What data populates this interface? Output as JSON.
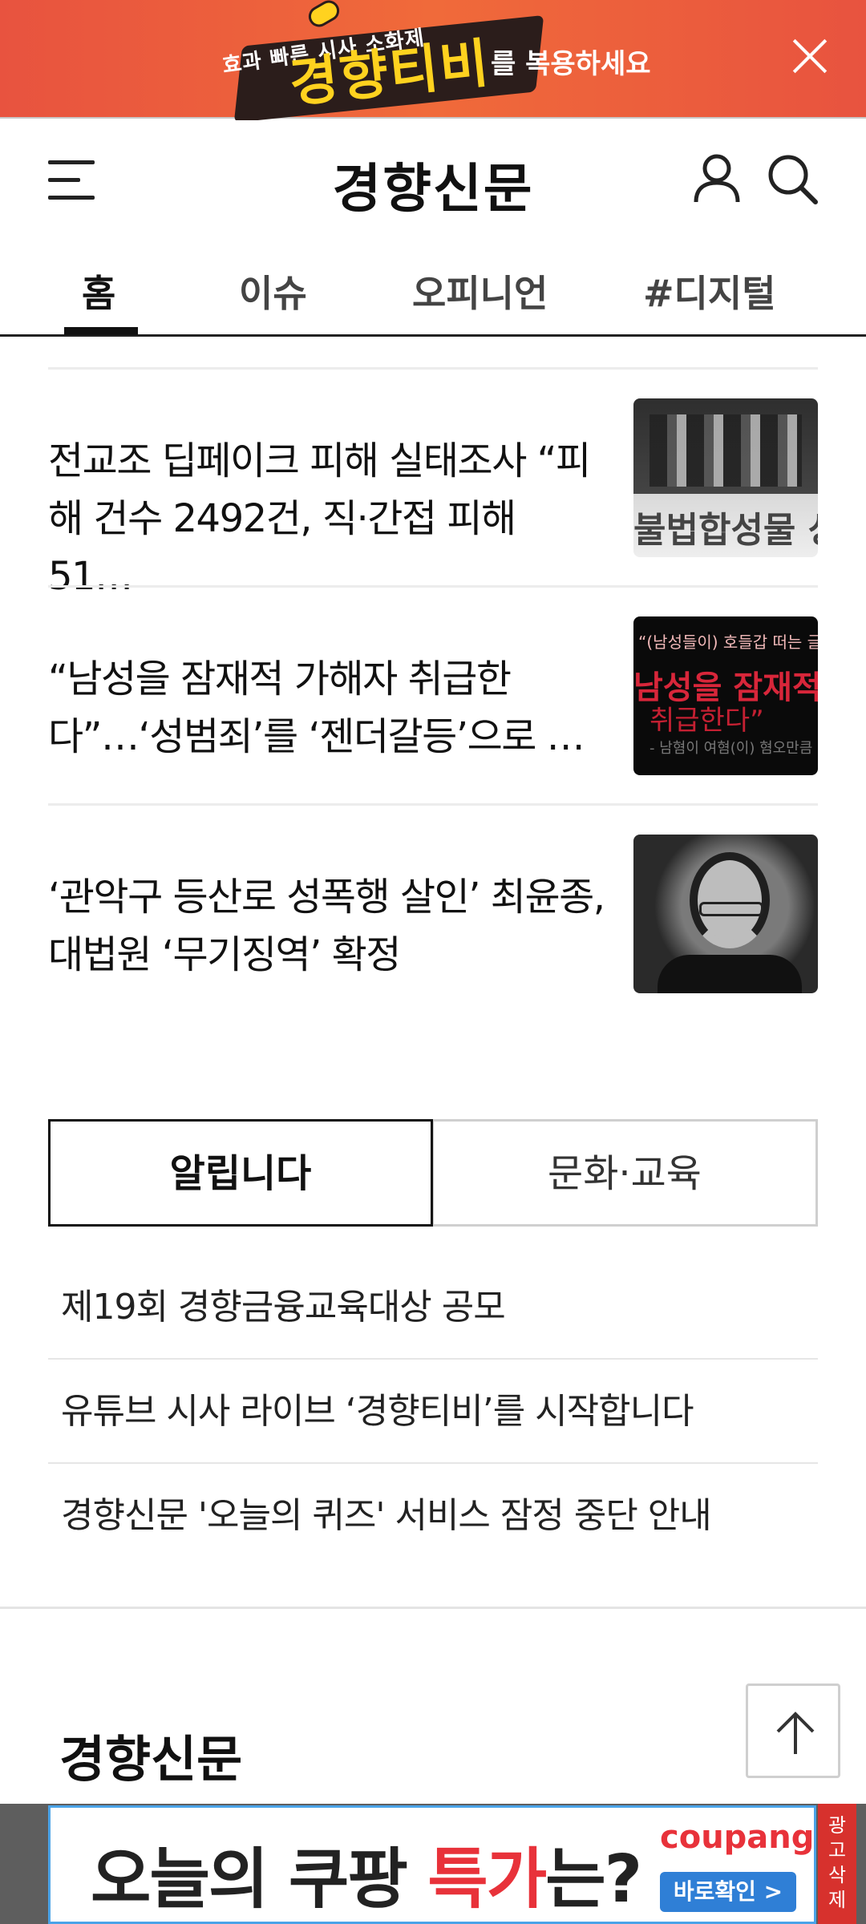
{
  "top_ad": {
    "subtext": "효과 빠른 시사 소화제",
    "brand": "경향티비",
    "tail": "를 복용하세요"
  },
  "header": {
    "logo": "경향신문"
  },
  "tabs": [
    {
      "label": "홈",
      "active": true
    },
    {
      "label": "이슈",
      "active": false
    },
    {
      "label": "오피니언",
      "active": false
    },
    {
      "label": "#디지털",
      "active": false
    }
  ],
  "articles": [
    {
      "headline": "전교조 딥페이크 피해 실태조사 “피해 건수 2492건, 직·간접 피해 51…",
      "thumb_caption": "불법합성물 상"
    },
    {
      "headline": "“남성을 잠재적 가해자 취급한다”…‘성범죄’를 ‘젠더갈등’으로 …",
      "thumb_lines": [
        "“(남성들이) 호들갑 떠는 글이 퍼지고 있”",
        "남성을 잠재적 가해자",
        "취급한다”",
        "- 남혐이 여혐(이) 혐오만큼 심각"
      ]
    },
    {
      "headline": "‘관악구 등산로 성폭행 살인’ 최윤종, 대법원 ‘무기징역’ 확정"
    }
  ],
  "notice_tabs": [
    {
      "label": "알립니다",
      "active": true
    },
    {
      "label": "문화·교육",
      "active": false
    }
  ],
  "notices": [
    "제19회 경향금융교육대상 공모",
    "유튜브 시사 라이브 ‘경향티비’를 시작합니다",
    "경향신문 '오늘의 퀴즈' 서비스 잠정 중단 안내"
  ],
  "footer": {
    "logo": "경향신문"
  },
  "bottom_ad": {
    "main_part1": "오늘",
    "main_part2": "의 쿠팡 ",
    "main_red": "특가",
    "main_part3": "는?",
    "brand": "coupang",
    "button": "바로확인 >",
    "delete_label": "광고삭제"
  },
  "colors": {
    "ad_orange": "#e8533f",
    "ad_yellow": "#ffd21f",
    "coupang_blue": "#2f7fd6",
    "ad_delete_red": "#d7312d"
  }
}
